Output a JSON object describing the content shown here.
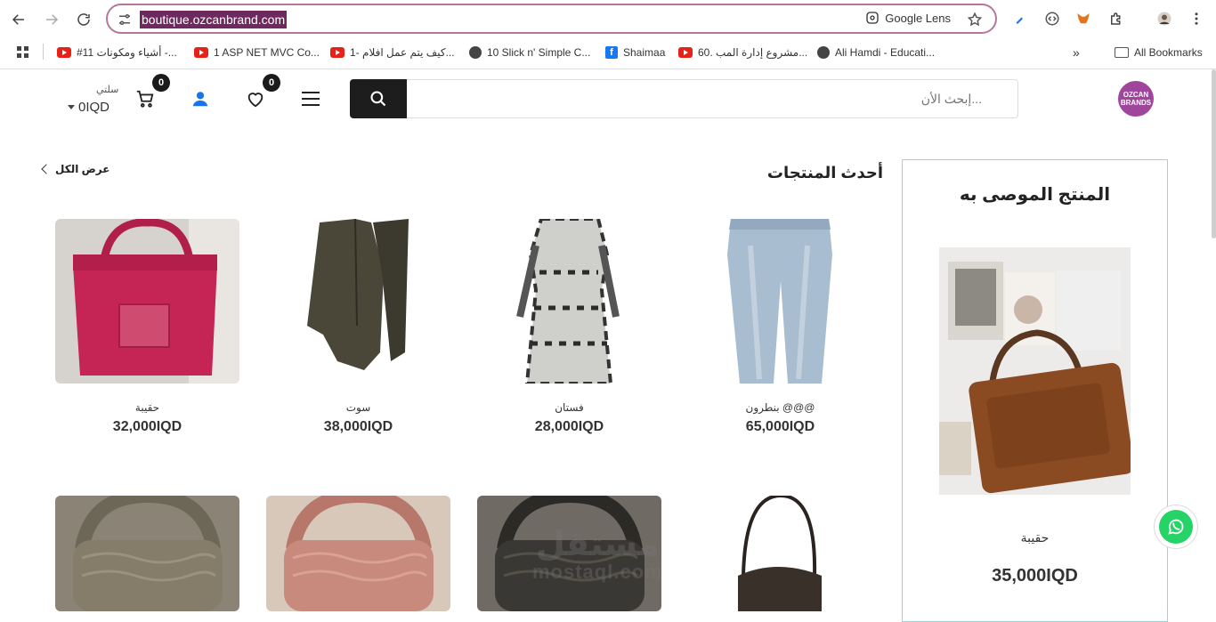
{
  "browser": {
    "url": "boutique.ozcanbrand.com",
    "lens_label": "Google Lens",
    "bookmarks": [
      "#11 أشياء ومكونات -...",
      "1 ASP NET MVC Co...",
      "1- كيف يتم عمل افلام...",
      "10 Slick n' Simple C...",
      "Shaimaa",
      "60. مشروع إدارة المب...",
      "Ali Hamdi - Educati..."
    ],
    "more": "»",
    "all_bookmarks": "All Bookmarks"
  },
  "header": {
    "logo_text": "OZCAN BRANDS",
    "search_placeholder": "إبحث الأن...",
    "wishlist_count": "0",
    "cart_count": "0",
    "cart_label": "سلتي",
    "cart_total": "0IQD"
  },
  "featured": {
    "title": "المنتج الموصى به",
    "name": "حقيبة",
    "price": "35,000IQD"
  },
  "latest": {
    "title": "أحدث المنتجات",
    "view_all": "عرض الكل",
    "products": [
      {
        "name": "بنطرون @@@",
        "price": "65,000IQD"
      },
      {
        "name": "فستان",
        "price": "28,000IQD"
      },
      {
        "name": "سوت",
        "price": "38,000IQD"
      },
      {
        "name": "حقيبة",
        "price": "32,000IQD"
      }
    ]
  },
  "watermark": {
    "ar": "مستقل",
    "en": "mostaql.com"
  }
}
